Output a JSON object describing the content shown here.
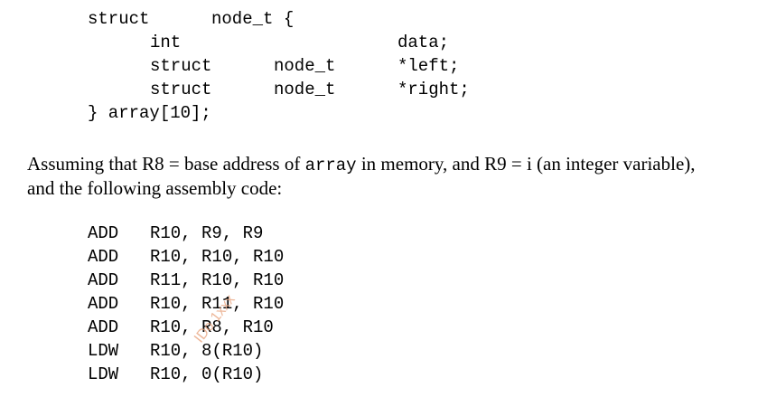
{
  "struct_block": {
    "header": {
      "kw": "struct",
      "name": "node_t {"
    },
    "fields": [
      {
        "type": "int",
        "subtype": "",
        "name": "data;"
      },
      {
        "type": "struct",
        "subtype": "node_t",
        "name": "*left;"
      },
      {
        "type": "struct",
        "subtype": "node_t",
        "name": "*right;"
      }
    ],
    "footer": "} array[10];"
  },
  "paragraph": {
    "line1_a": "Assuming that R8 = base address of ",
    "line1_code": "array",
    "line1_b": " in memory, and R9 = i (an integer variable),",
    "line2": "and the following assembly code:"
  },
  "assembly": [
    {
      "op": "ADD",
      "args": "R10, R9, R9"
    },
    {
      "op": "ADD",
      "args": "R10, R10, R10"
    },
    {
      "op": "ADD",
      "args": "R11, R10, R10"
    },
    {
      "op": "ADD",
      "args": "R10, R11, R10"
    },
    {
      "op": "ADD",
      "args": "R10, R8, R10"
    },
    {
      "op": "LDW",
      "args": "R10, 8(R10)"
    },
    {
      "op": "LDW",
      "args": "R10, 0(R10)"
    }
  ],
  "watermark": {
    "text": "IDo 1xxx",
    "color": "#e8a17a"
  }
}
